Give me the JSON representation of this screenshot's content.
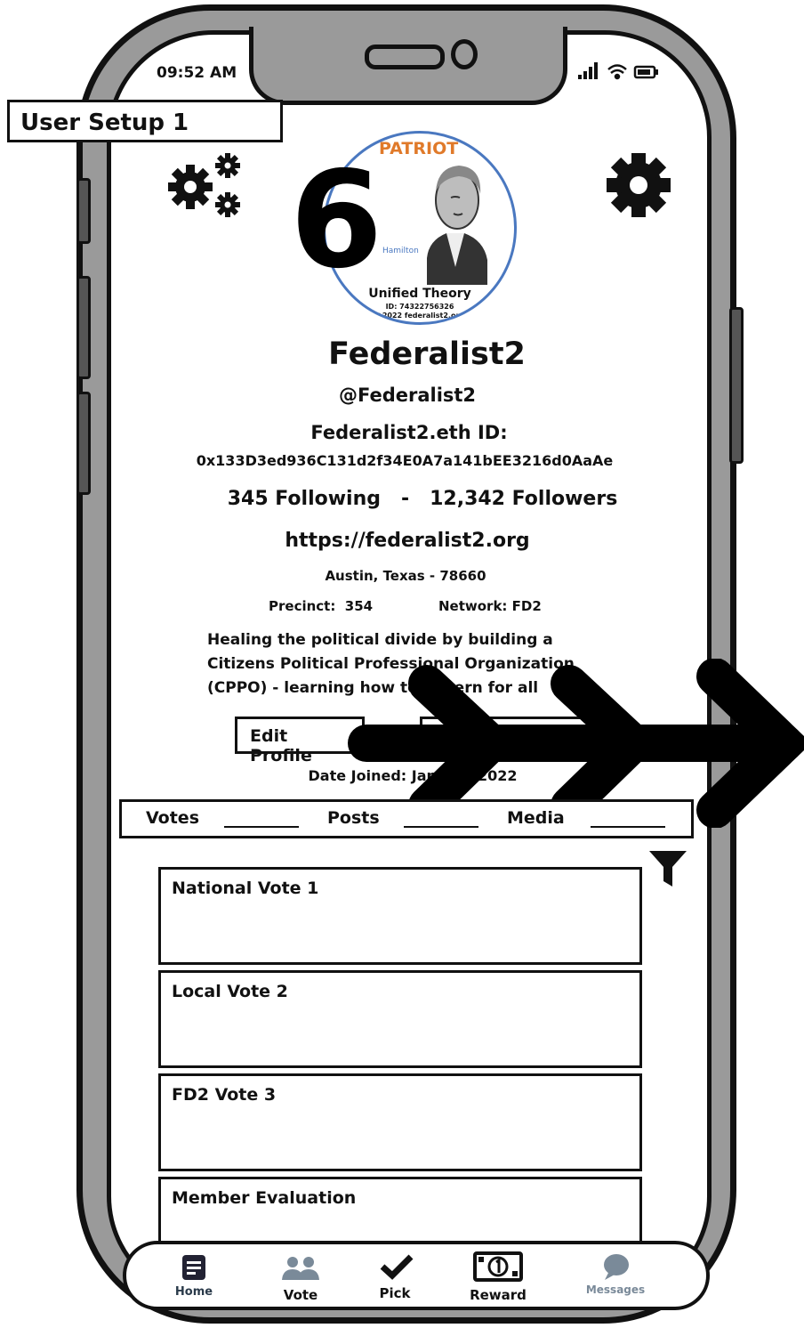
{
  "status_bar": {
    "time": "09:52 AM"
  },
  "screen_label": "User Setup 1",
  "badge": {
    "number": "6",
    "top_text": "PATRIOT",
    "side_text": "Hamilton",
    "title": "Unified Theory",
    "id_line": "ID: 74322756326",
    "copyright": "©2022 federalist2.org"
  },
  "profile": {
    "name": "Federalist2",
    "handle": "@Federalist2",
    "eth_label": "Federalist2.eth ID:",
    "eth_address": "0x133D3ed936C131d2f34E0A7a141bEE3216d0AaAe",
    "follow_stats": "345 Following   -   12,342 Followers",
    "url": "https://federalist2.org",
    "location": "Austin, Texas - 78660",
    "precinct": "Precinct:  354",
    "network": "Network: FD2",
    "bio": [
      "Healing the political divide by building a",
      "Citizens Political Professional Organization",
      "(CPPO) - learning how to govern for all"
    ],
    "edit_button": "Edit Profile",
    "date_joined": "Date Joined: January 2022"
  },
  "tabs": {
    "votes": "Votes",
    "posts": "Posts",
    "media": "Media"
  },
  "vote_cards": [
    "National Vote 1",
    "Local Vote 2",
    "FD2 Vote 3",
    "Member Evaluation"
  ],
  "tabbar": {
    "home": "Home",
    "vote": "Vote",
    "pick": "Pick",
    "reward": "Reward",
    "messages": "Messages"
  },
  "colors": {
    "badge_ring": "#4a78c0",
    "badge_text": "#e07a2a",
    "tab_muted": "#7a8a99"
  }
}
